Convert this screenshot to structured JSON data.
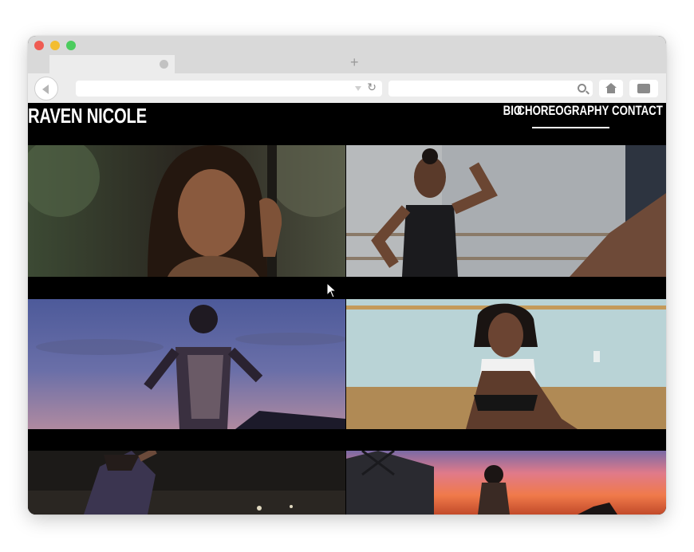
{
  "browser": {
    "tabs": [
      {
        "label": "",
        "active": true
      },
      {
        "label": "",
        "active": false
      },
      {
        "label": "",
        "active": false
      }
    ],
    "url": "",
    "search": ""
  },
  "site": {
    "logo": "RAVEN NICOLE",
    "nav": [
      {
        "label": "BIO",
        "active": false
      },
      {
        "label": "CHOREOGRAPHY",
        "active": true
      },
      {
        "label": "CONTACT",
        "active": false
      }
    ]
  },
  "gallery": {
    "tiles": [
      {
        "name": "tile-portrait-forest"
      },
      {
        "name": "tile-studio-flex"
      },
      {
        "name": "tile-dusk-silhouette"
      },
      {
        "name": "tile-studio-crouch"
      },
      {
        "name": "tile-night-dance"
      },
      {
        "name": "tile-sunset-dance"
      }
    ]
  },
  "colors": {
    "page_bg": "#000000",
    "text": "#ffffff"
  }
}
